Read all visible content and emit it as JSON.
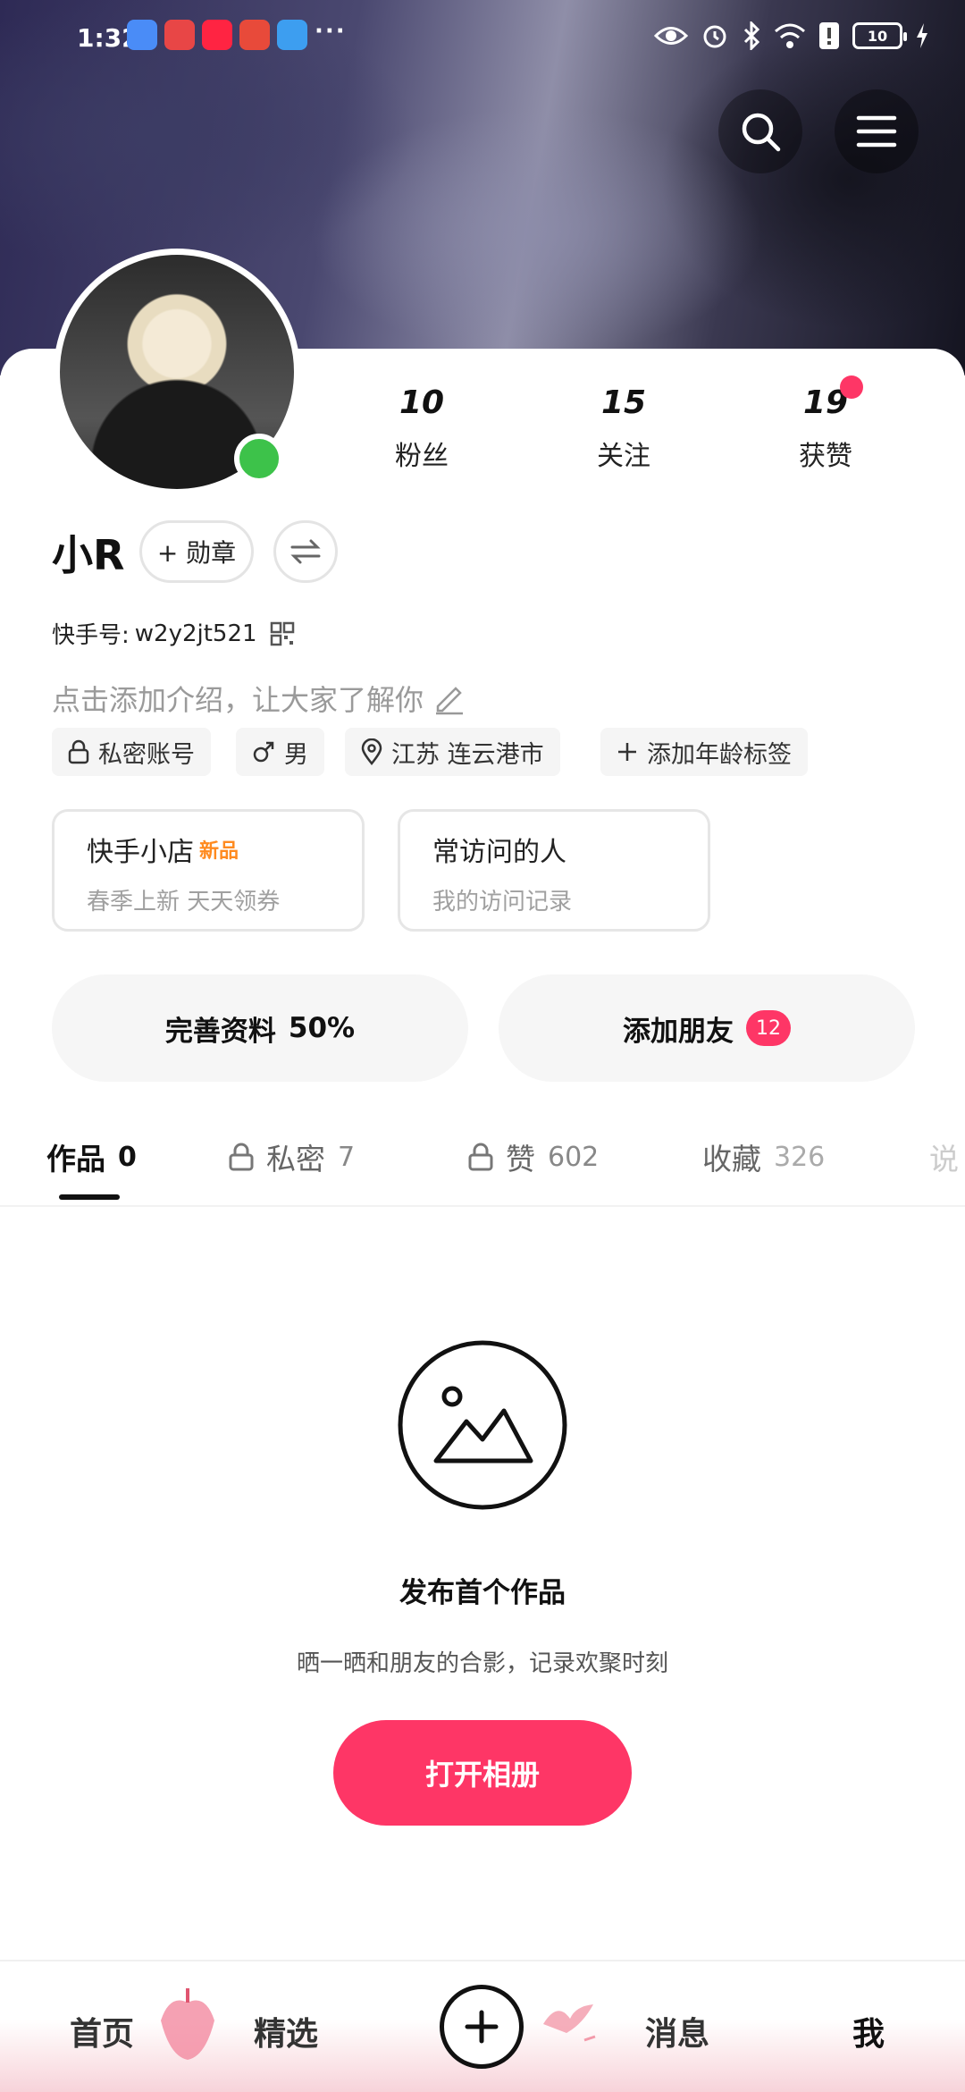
{
  "status_bar": {
    "time": "1:32",
    "battery": "10",
    "app_icons": [
      "cloud-app-icon",
      "reader-app-icon",
      "xiaohongshu-app-icon",
      "huawei-app-icon",
      "browser-app-icon"
    ],
    "more": "···"
  },
  "profile": {
    "name": "小R",
    "badge_button": "+ 勋章",
    "kuaishou_id_label": "快手号:",
    "kuaishou_id": "w2y2jt521",
    "intro_placeholder": "点击添加介绍，让大家了解你",
    "stats": [
      {
        "value": "10",
        "label": "粉丝"
      },
      {
        "value": "15",
        "label": "关注"
      },
      {
        "value": "19",
        "label": "获赞"
      }
    ],
    "tags": [
      "私密账号",
      "男",
      "江苏 连云港市",
      "添加年龄标签"
    ]
  },
  "cards": [
    {
      "title": "快手小店",
      "badge": "新品",
      "subtitle": "春季上新 天天领券"
    },
    {
      "title": "常访问的人",
      "subtitle": "我的访问记录"
    }
  ],
  "actions": {
    "complete_profile": "完善资料",
    "complete_percent": "50%",
    "add_friends": "添加朋友",
    "add_friends_count": "12"
  },
  "tabs": [
    {
      "label": "作品",
      "count": "0"
    },
    {
      "label": "私密",
      "count": "7"
    },
    {
      "label": "赞",
      "count": "602"
    },
    {
      "label": "收藏",
      "count": "326"
    },
    {
      "label": "说"
    }
  ],
  "empty_state": {
    "title": "发布首个作品",
    "subtitle": "晒一晒和朋友的合影，记录欢聚时刻",
    "button": "打开相册"
  },
  "bottom_nav": [
    "首页",
    "精选",
    "消息",
    "我"
  ],
  "colors": {
    "accent": "#fe3666",
    "online": "#3dc24a"
  }
}
